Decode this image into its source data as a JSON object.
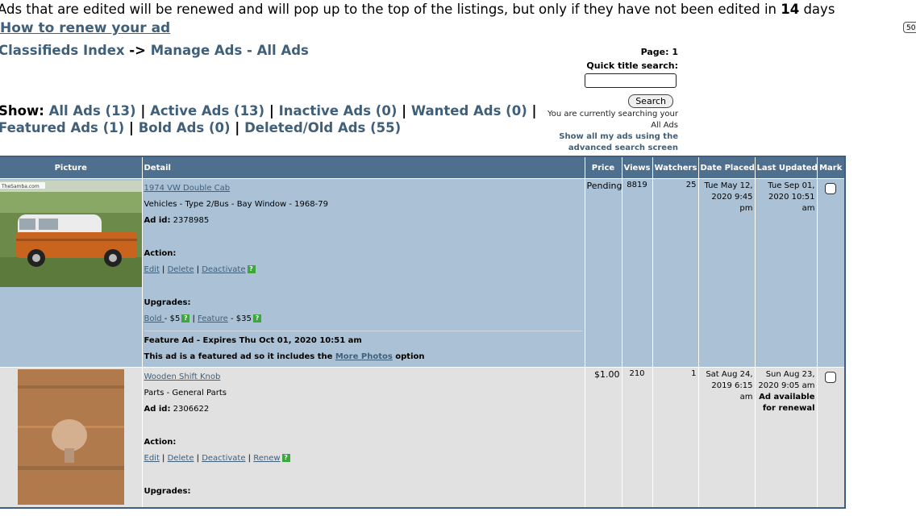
{
  "notice": {
    "text_before": "Ads that are edited will be renewed and will pop up to the top of the listings, but only if they have not been edited in ",
    "days": "14",
    "text_after": " days"
  },
  "how_to_renew": "How to renew your ad",
  "breadcrumb": {
    "index": "Classifieds Index",
    "arrow": " -> ",
    "current": "Manage Ads - All Ads"
  },
  "edge_button": "50",
  "page_box": {
    "page_label": "Page: 1",
    "quick_title_label": "Quick title search:",
    "search_input_value": "",
    "search_button": "Search",
    "currently_searching": "You are currently searching your All Ads",
    "advanced_link": "Show all my ads using the advanced search screen"
  },
  "show": {
    "label": "Show:",
    "filters": [
      "All Ads (13)",
      "Active Ads (13)",
      "Inactive Ads (0)",
      "Wanted Ads (0)",
      "Featured Ads (1)",
      "Bold Ads (0)",
      "Deleted/Old Ads (55)"
    ]
  },
  "table": {
    "headers": [
      "Picture",
      "Detail",
      "Price",
      "Views",
      "Watchers",
      "Date Placed",
      "Last Updated",
      "Mark"
    ],
    "rows": [
      {
        "title": "1974 VW Double Cab ",
        "category": "Vehicles - Type 2/Bus - Bay Window - 1968-79",
        "ad_id_label": "Ad id:",
        "ad_id": "2378985",
        "action_label": "Action:",
        "actions": [
          "Edit",
          "Delete",
          "Deactivate"
        ],
        "upgrades_label": "Upgrades:",
        "upgrade_bold": "Bold ",
        "upgrade_bold_price": " - $5",
        "upgrade_feature": "Feature",
        "upgrade_feature_price": " - $35",
        "feature_line1": "Feature Ad - Expires Thu Oct 01, 2020 10:51 am",
        "feature_line2_before": "This ad is a featured ad so it includes the ",
        "feature_line2_link": "More Photos",
        "feature_line2_after": " option",
        "price": "Pending",
        "views": "8819",
        "watchers": "25",
        "date_placed": "Tue May 12, 2020 9:45 pm",
        "last_updated": "Tue Sep 01, 2020 10:51 am",
        "photo_watermark": "TheSamba.com"
      },
      {
        "title": "Wooden Shift Knob ",
        "category": "Parts - General Parts",
        "ad_id_label": "Ad id:",
        "ad_id": "2306622",
        "action_label": "Action:",
        "actions": [
          "Edit",
          "Delete",
          "Deactivate",
          "Renew"
        ],
        "upgrades_label": "Upgrades:",
        "price": "$1.00",
        "views": "210",
        "watchers": "1",
        "date_placed": "Sat Aug 24, 2019 6:15 am",
        "last_updated": "Sun Aug 23, 2020 9:05 am",
        "renewal_note": "Ad available for renewal"
      }
    ]
  },
  "colors": {
    "link": "#3f5f7a",
    "header_bg": "#4f6f8f",
    "row_featured_bg": "#abc2d6",
    "row_normal_bg": "#e1e1e1",
    "help_icon": "#3da63d"
  }
}
